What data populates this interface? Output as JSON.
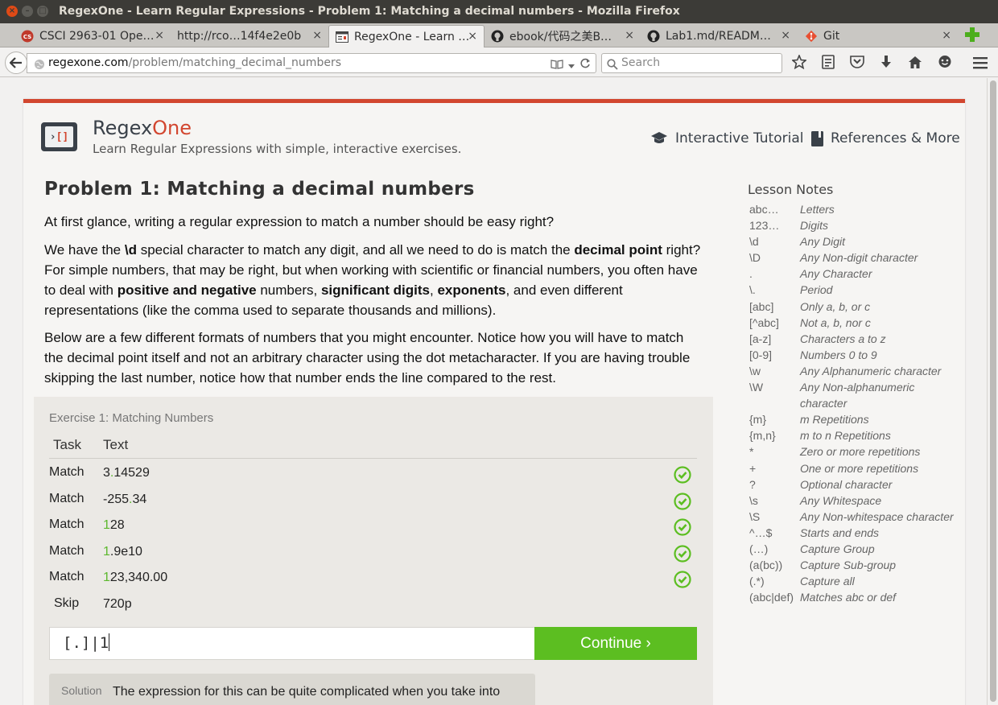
{
  "window": {
    "title": "RegexOne - Learn Regular Expressions - Problem 1: Matching a decimal numbers - Mozilla Firefox",
    "buttons": [
      "×",
      "–",
      "□"
    ]
  },
  "tabs": [
    {
      "label": "CSCI 2963-01 Ope…",
      "icon": "cs-favicon-icon",
      "close": "×"
    },
    {
      "label": "http://rco…14f4e2e0b",
      "icon": "none",
      "close": "×"
    },
    {
      "label": "RegexOne - Learn …",
      "icon": "reader-page-icon",
      "close": "×",
      "active": true
    },
    {
      "label": "ebook/代码之美B…",
      "icon": "github-icon",
      "close": "×"
    },
    {
      "label": "Lab1.md/READM…",
      "icon": "github-icon",
      "close": "×"
    },
    {
      "label": "Git",
      "icon": "git-icon",
      "close": "×"
    }
  ],
  "navbar": {
    "url_host": "regexone.com",
    "url_path": "/problem/matching_decimal_numbers",
    "search_placeholder": "Search"
  },
  "site": {
    "brand_regex": "Regex",
    "brand_one": "One",
    "tagline": "Learn Regular Expressions with simple, interactive exercises.",
    "nav": {
      "tutorial": "Interactive Tutorial",
      "references": "References & More"
    },
    "colors": {
      "accent": "#d2462f",
      "success": "#5cbe21"
    }
  },
  "problem": {
    "title": "Problem 1: Matching a decimal numbers",
    "p1": "At first glance, writing a regular expression to match a number should be easy right?",
    "p2": {
      "a": "We have the ",
      "b": "\\d",
      "c": " special character to match any digit, and all we need to do is match the ",
      "d": "decimal point",
      "e": " right? For simple numbers, that may be right, but when working with scientific or financial numbers, you often have to deal with ",
      "f": "positive and negative",
      "g": " numbers, ",
      "h": "significant digits",
      "i": ", ",
      "j": "exponents",
      "k": ", and even different representations (like the comma used to separate thousands and millions)."
    },
    "p3": "Below are a few different formats of numbers that you might encounter. Notice how you will have to match the decimal point itself and not an arbitrary character using the dot metacharacter. If you are having trouble skipping the last number, notice how that number ends the line compared to the rest."
  },
  "exercise": {
    "title": "Exercise 1: Matching Numbers",
    "col_task": "Task",
    "col_text": "Text",
    "rows": [
      {
        "task": "Match",
        "pre": "3",
        "hl": ".",
        "post": "14529"
      },
      {
        "task": "Match",
        "pre": "-255",
        "hl": ".",
        "post": "34"
      },
      {
        "task": "Match",
        "pre": "",
        "hl": "1",
        "post": "28"
      },
      {
        "task": "Match",
        "pre": "",
        "hl": "1",
        "post": ".9e10"
      },
      {
        "task": "Match",
        "pre": "",
        "hl": "1",
        "post": "23,340.00"
      },
      {
        "task": "Skip",
        "pre": "720p",
        "hl": "",
        "post": ""
      }
    ],
    "input_value": "[.]|1",
    "continue_label": "Continue ›",
    "solution_label": "Solution",
    "solution_text": "The expression for this can be quite complicated when you take into"
  },
  "lesson_notes": {
    "title": "Lesson Notes",
    "items": [
      {
        "k": "abc…",
        "v": "Letters"
      },
      {
        "k": "123…",
        "v": "Digits"
      },
      {
        "k": "\\d",
        "v": "Any Digit"
      },
      {
        "k": "\\D",
        "v": "Any Non-digit character"
      },
      {
        "k": ".",
        "v": "Any Character"
      },
      {
        "k": "\\.",
        "v": "Period"
      },
      {
        "k": "[abc]",
        "v": "Only a, b, or c"
      },
      {
        "k": "[^abc]",
        "v": "Not a, b, nor c"
      },
      {
        "k": "[a-z]",
        "v": "Characters a to z"
      },
      {
        "k": "[0-9]",
        "v": "Numbers 0 to 9"
      },
      {
        "k": "\\w",
        "v": "Any Alphanumeric character"
      },
      {
        "k": "\\W",
        "v": "Any Non-alphanumeric character"
      },
      {
        "k": "{m}",
        "v": "m Repetitions"
      },
      {
        "k": "{m,n}",
        "v": "m to n Repetitions"
      },
      {
        "k": "*",
        "v": "Zero or more repetitions"
      },
      {
        "k": "+",
        "v": "One or more repetitions"
      },
      {
        "k": "?",
        "v": "Optional character"
      },
      {
        "k": "\\s",
        "v": "Any Whitespace"
      },
      {
        "k": "\\S",
        "v": "Any Non-whitespace character"
      },
      {
        "k": "^…$",
        "v": "Starts and ends"
      },
      {
        "k": "(…)",
        "v": "Capture Group"
      },
      {
        "k": "(a(bc))",
        "v": "Capture Sub-group"
      },
      {
        "k": "(.*)",
        "v": "Capture all"
      },
      {
        "k": "(abc|def)",
        "v": "Matches abc or def"
      }
    ]
  }
}
